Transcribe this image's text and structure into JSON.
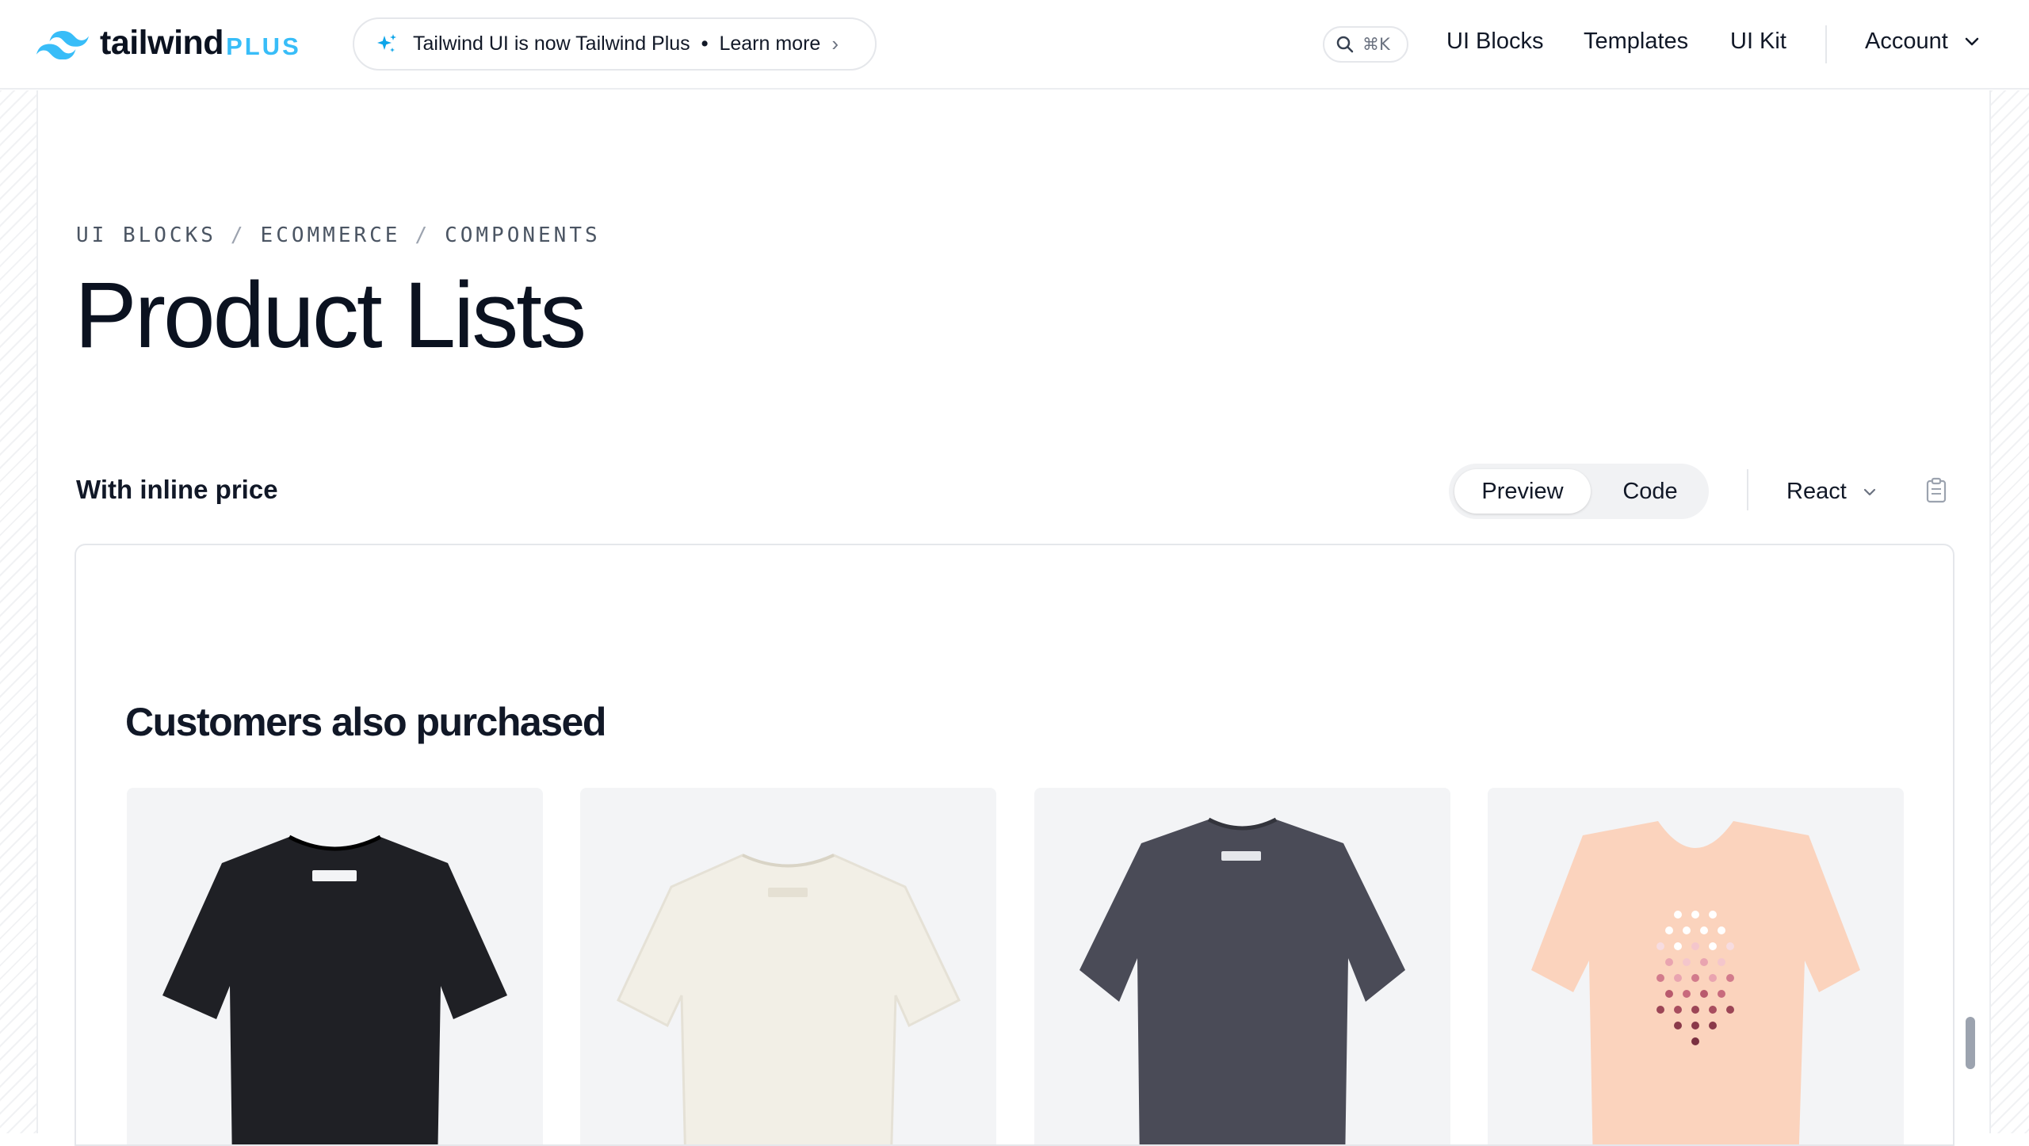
{
  "brand": {
    "word": "tailwind",
    "plus": "PLUS",
    "accent": "#38bdf8"
  },
  "announcement": {
    "text": "Tailwind UI is now Tailwind Plus",
    "link": "Learn more"
  },
  "search": {
    "shortcut": "⌘K"
  },
  "nav": {
    "items": [
      "UI Blocks",
      "Templates",
      "UI Kit"
    ],
    "account": "Account"
  },
  "breadcrumb": [
    "UI BLOCKS",
    "ECOMMERCE",
    "COMPONENTS"
  ],
  "page_title": "Product Lists",
  "section": {
    "title": "With inline price",
    "tabs": {
      "preview": "Preview",
      "code": "Code"
    },
    "framework": "React"
  },
  "preview": {
    "heading": "Customers also purchased",
    "products": [
      {
        "name": "black-tee",
        "color": "#1f2025"
      },
      {
        "name": "ivory-tee",
        "color": "#f2efe6"
      },
      {
        "name": "charcoal-tee",
        "color": "#4a4b57"
      },
      {
        "name": "peach-tee",
        "color": "#fbd3bd"
      }
    ]
  }
}
